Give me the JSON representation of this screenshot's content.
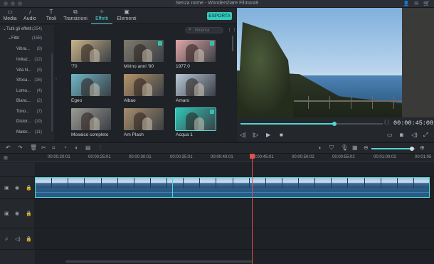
{
  "window": {
    "title": "Senza nome - Wondershare Filmora9"
  },
  "tabs": [
    {
      "label": "Media",
      "icon": "folder-icon"
    },
    {
      "label": "Audio",
      "icon": "music-note-icon"
    },
    {
      "label": "Titoli",
      "icon": "text-icon"
    },
    {
      "label": "Transizioni",
      "icon": "transition-icon"
    },
    {
      "label": "Effetti",
      "icon": "effects-icon",
      "active": true
    },
    {
      "label": "Elementi",
      "icon": "image-icon"
    }
  ],
  "export_label": "ESPORTA",
  "sidebar": {
    "all_effects": {
      "label": "Tutti gli effetti",
      "count": "(254)"
    },
    "filters": {
      "label": "Filtri",
      "count": "(158)"
    },
    "items": [
      {
        "label": "Vibra...",
        "count": "(8)"
      },
      {
        "label": "Imitaz...",
        "count": "(12)"
      },
      {
        "label": "Vita N...",
        "count": "(3)"
      },
      {
        "label": "Sfoca...",
        "count": "(16)"
      },
      {
        "label": "Lomo...",
        "count": "(4)"
      },
      {
        "label": "Bianc...",
        "count": "(2)"
      },
      {
        "label": "Tono...",
        "count": "(7)"
      },
      {
        "label": "Distor...",
        "count": "(19)"
      },
      {
        "label": "Mater...",
        "count": "(11)"
      }
    ]
  },
  "search": {
    "placeholder": "Ricerca"
  },
  "effects": [
    {
      "label": "'70",
      "tint": "#c9b48a"
    },
    {
      "label": "Mirino anni '90",
      "tint": "#7e7a6d",
      "download": true
    },
    {
      "label": "1977.0",
      "tint": "#e0a6a8",
      "download": true
    },
    {
      "label": "Egeo",
      "tint": "#6fb7c7"
    },
    {
      "label": "Albao",
      "tint": "#b5946a"
    },
    {
      "label": "Amaro",
      "tint": "#b8c7d6"
    },
    {
      "label": "Mosaico completo",
      "tint": "#9b9b93"
    },
    {
      "label": "Am Plash",
      "tint": "#a78d6c"
    },
    {
      "label": "Acqua 1",
      "tint": "#2fc7b8",
      "download": true,
      "selected": true
    }
  ],
  "preview": {
    "timecode": "00:00:45:08",
    "progress": 0.66
  },
  "ruler": {
    "labels": [
      "00:00:20:01",
      "00:00:25:01",
      "00:00:30:01",
      "00:00:35:01",
      "00:00:40:01",
      "00:00:45:01",
      "00:00:50:02",
      "00:00:55:02",
      "00:01:00:02",
      "00:01:05"
    ]
  },
  "zoom": {
    "level": 0.92
  }
}
